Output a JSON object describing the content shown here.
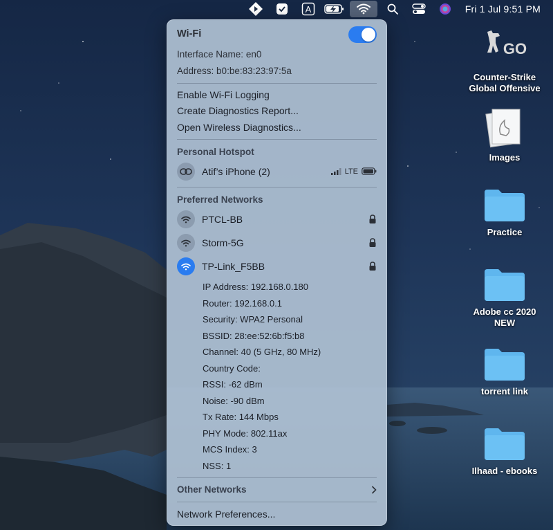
{
  "menubar": {
    "clock": "Fri 1 Jul  9:51 PM",
    "icons": [
      "kite-icon",
      "checkbox-icon",
      "keyboard-a-icon",
      "battery-charging-icon",
      "wifi-icon",
      "search-icon",
      "control-center-icon",
      "siri-icon"
    ]
  },
  "wifi_menu": {
    "title": "Wi-Fi",
    "enabled": true,
    "interface_name_label": "Interface Name:",
    "interface_name_value": "en0",
    "address_label": "Address:",
    "address_value": "b0:be:83:23:97:5a",
    "actions": [
      "Enable Wi-Fi Logging",
      "Create Diagnostics Report...",
      "Open Wireless Diagnostics..."
    ],
    "hotspot": {
      "section_title": "Personal Hotspot",
      "device": "Atif’s iPhone (2)",
      "signal_type": "LTE"
    },
    "preferred": {
      "section_title": "Preferred Networks",
      "networks": [
        {
          "name": "PTCL-BB",
          "secured": true,
          "connected": false
        },
        {
          "name": "Storm-5G",
          "secured": true,
          "connected": false
        },
        {
          "name": "TP-Link_F5BB",
          "secured": true,
          "connected": true
        }
      ],
      "details": [
        "IP Address: 192.168.0.180",
        "Router: 192.168.0.1",
        "Security: WPA2 Personal",
        "BSSID: 28:ee:52:6b:f5:b8",
        "Channel: 40 (5 GHz, 80 MHz)",
        "Country Code:",
        "RSSI: -62 dBm",
        "Noise: -90 dBm",
        "Tx Rate: 144 Mbps",
        "PHY Mode: 802.11ax",
        "MCS Index: 3",
        "NSS: 1"
      ]
    },
    "other_networks": "Other Networks",
    "network_preferences": "Network Preferences..."
  },
  "desktop": {
    "items": [
      {
        "label_line1": "Counter-Strike",
        "label_line2": "Global Offensive",
        "icon": "csgo-icon"
      },
      {
        "label_line1": "Images",
        "label_line2": "",
        "icon": "images-icon"
      },
      {
        "label_line1": "Practice",
        "label_line2": "",
        "icon": "folder-icon"
      },
      {
        "label_line1": "Adobe cc 2020",
        "label_line2": "NEW",
        "icon": "folder-icon"
      },
      {
        "label_line1": "torrent link",
        "label_line2": "",
        "icon": "folder-icon"
      },
      {
        "label_line1": "Ilhaad - ebooks",
        "label_line2": "",
        "icon": "folder-icon"
      }
    ]
  },
  "colors": {
    "accent": "#2a7cf0",
    "folder": "#5fb6ee"
  }
}
